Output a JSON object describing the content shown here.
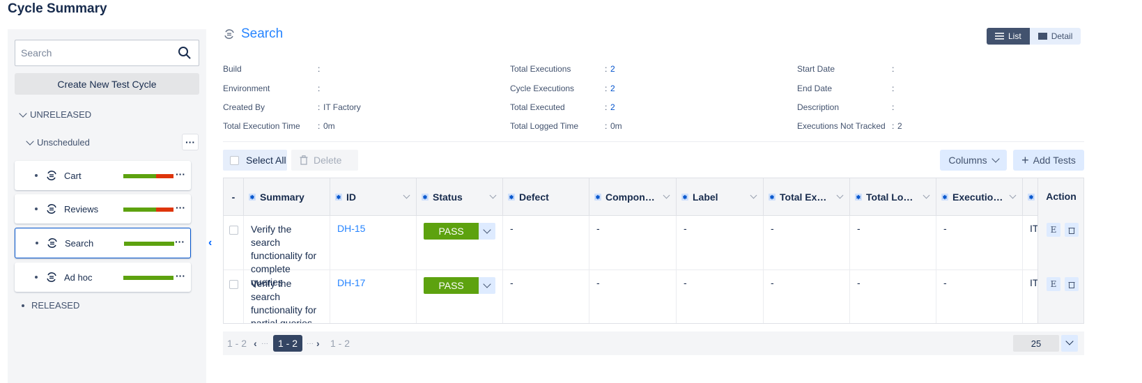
{
  "page": {
    "title": "Cycle Summary"
  },
  "sidebar": {
    "search_placeholder": "Search",
    "create_label": "Create New Test Cycle",
    "groups": {
      "unreleased": "UNRELEASED",
      "unscheduled": "Unscheduled",
      "released": "RELEASED"
    },
    "cycles": [
      {
        "name": "Cart",
        "pass_fraction": 0.65,
        "fail_fraction": 0.35
      },
      {
        "name": "Reviews",
        "pass_fraction": 0.65,
        "fail_fraction": 0.35
      },
      {
        "name": "Search",
        "pass_fraction": 1.0,
        "fail_fraction": 0.0,
        "selected": true
      },
      {
        "name": "Ad hoc",
        "pass_fraction": 1.0,
        "fail_fraction": 0.0
      }
    ],
    "more_label": "···"
  },
  "main": {
    "title": "Search",
    "view": {
      "list": "List",
      "detail": "Detail"
    },
    "info": {
      "build": {
        "label": "Build",
        "value": ""
      },
      "environment": {
        "label": "Environment",
        "value": ""
      },
      "created_by": {
        "label": "Created By",
        "value": "IT Factory"
      },
      "total_execution_time": {
        "label": "Total Execution Time",
        "value": "0m"
      },
      "total_executions": {
        "label": "Total Executions",
        "value": "2"
      },
      "cycle_executions": {
        "label": "Cycle Executions",
        "value": "2"
      },
      "total_executed": {
        "label": "Total Executed",
        "value": "2"
      },
      "total_logged_time": {
        "label": "Total Logged Time",
        "value": "0m"
      },
      "start_date": {
        "label": "Start Date",
        "value": ""
      },
      "end_date": {
        "label": "End Date",
        "value": ""
      },
      "description": {
        "label": "Description",
        "value": ""
      },
      "executions_not_tracked": {
        "label": "Executions Not Tracked",
        "value": "2"
      },
      "separator": ":"
    },
    "toolbar": {
      "select_all": "Select All",
      "delete": "Delete",
      "columns": "Columns",
      "add_tests": "Add Tests"
    },
    "table": {
      "headers": {
        "dash": "-",
        "summary": "Summary",
        "id": "ID",
        "status": "Status",
        "defect": "Defect",
        "component": "Compon…",
        "label": "Label",
        "total_ex": "Total Ex…",
        "total_lo": "Total Lo…",
        "execution": "Executio…",
        "action": "Action"
      },
      "rows": [
        {
          "summary": "Verify the search functionality for complete queries",
          "id": "DH-15",
          "status": "PASS",
          "defect": "-",
          "component": "-",
          "label": "-",
          "total_ex": "-",
          "total_lo": "-",
          "execution": "-",
          "executed_by": "IT",
          "edit_icon": "E"
        },
        {
          "summary": "Verify the search functionality for partial queries",
          "id": "DH-17",
          "status": "PASS",
          "defect": "-",
          "component": "-",
          "label": "-",
          "total_ex": "-",
          "total_lo": "-",
          "execution": "-",
          "executed_by": "IT",
          "edit_icon": "E"
        }
      ]
    },
    "pager": {
      "left_range": "1 - 2",
      "current": "1 - 2",
      "right_range": "1 - 2",
      "page_size": "25"
    }
  },
  "colors": {
    "pass": "#5da20f",
    "fail": "#de350b",
    "accent": "#2684ff",
    "selected_border": "#0052cc"
  }
}
